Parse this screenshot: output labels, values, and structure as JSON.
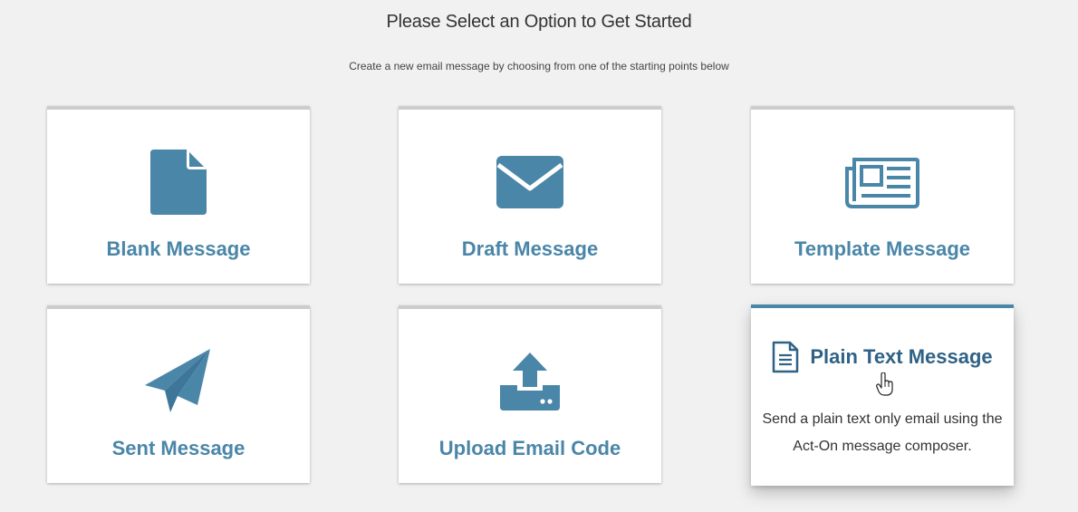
{
  "header": {
    "title": "Please Select an Option to Get Started",
    "subtitle": "Create a new email message by choosing from one of the starting points below"
  },
  "options": [
    {
      "label": "Blank Message",
      "icon": "document-icon"
    },
    {
      "label": "Draft Message",
      "icon": "envelope-icon"
    },
    {
      "label": "Template Message",
      "icon": "newspaper-icon"
    },
    {
      "label": "Sent Message",
      "icon": "paper-plane-icon"
    },
    {
      "label": "Upload Email Code",
      "icon": "upload-icon"
    },
    {
      "label": "Plain Text Message",
      "icon": "text-document-icon",
      "description": "Send a plain text only email using the Act-On message composer.",
      "state": "hovered"
    }
  ],
  "colors": {
    "icon": "#4a86a8",
    "label": "#4a86a8",
    "active_label": "#2f6286",
    "active_border": "#4a86a8",
    "card_top_border": "#cccccc",
    "background": "#f1f1f1"
  }
}
